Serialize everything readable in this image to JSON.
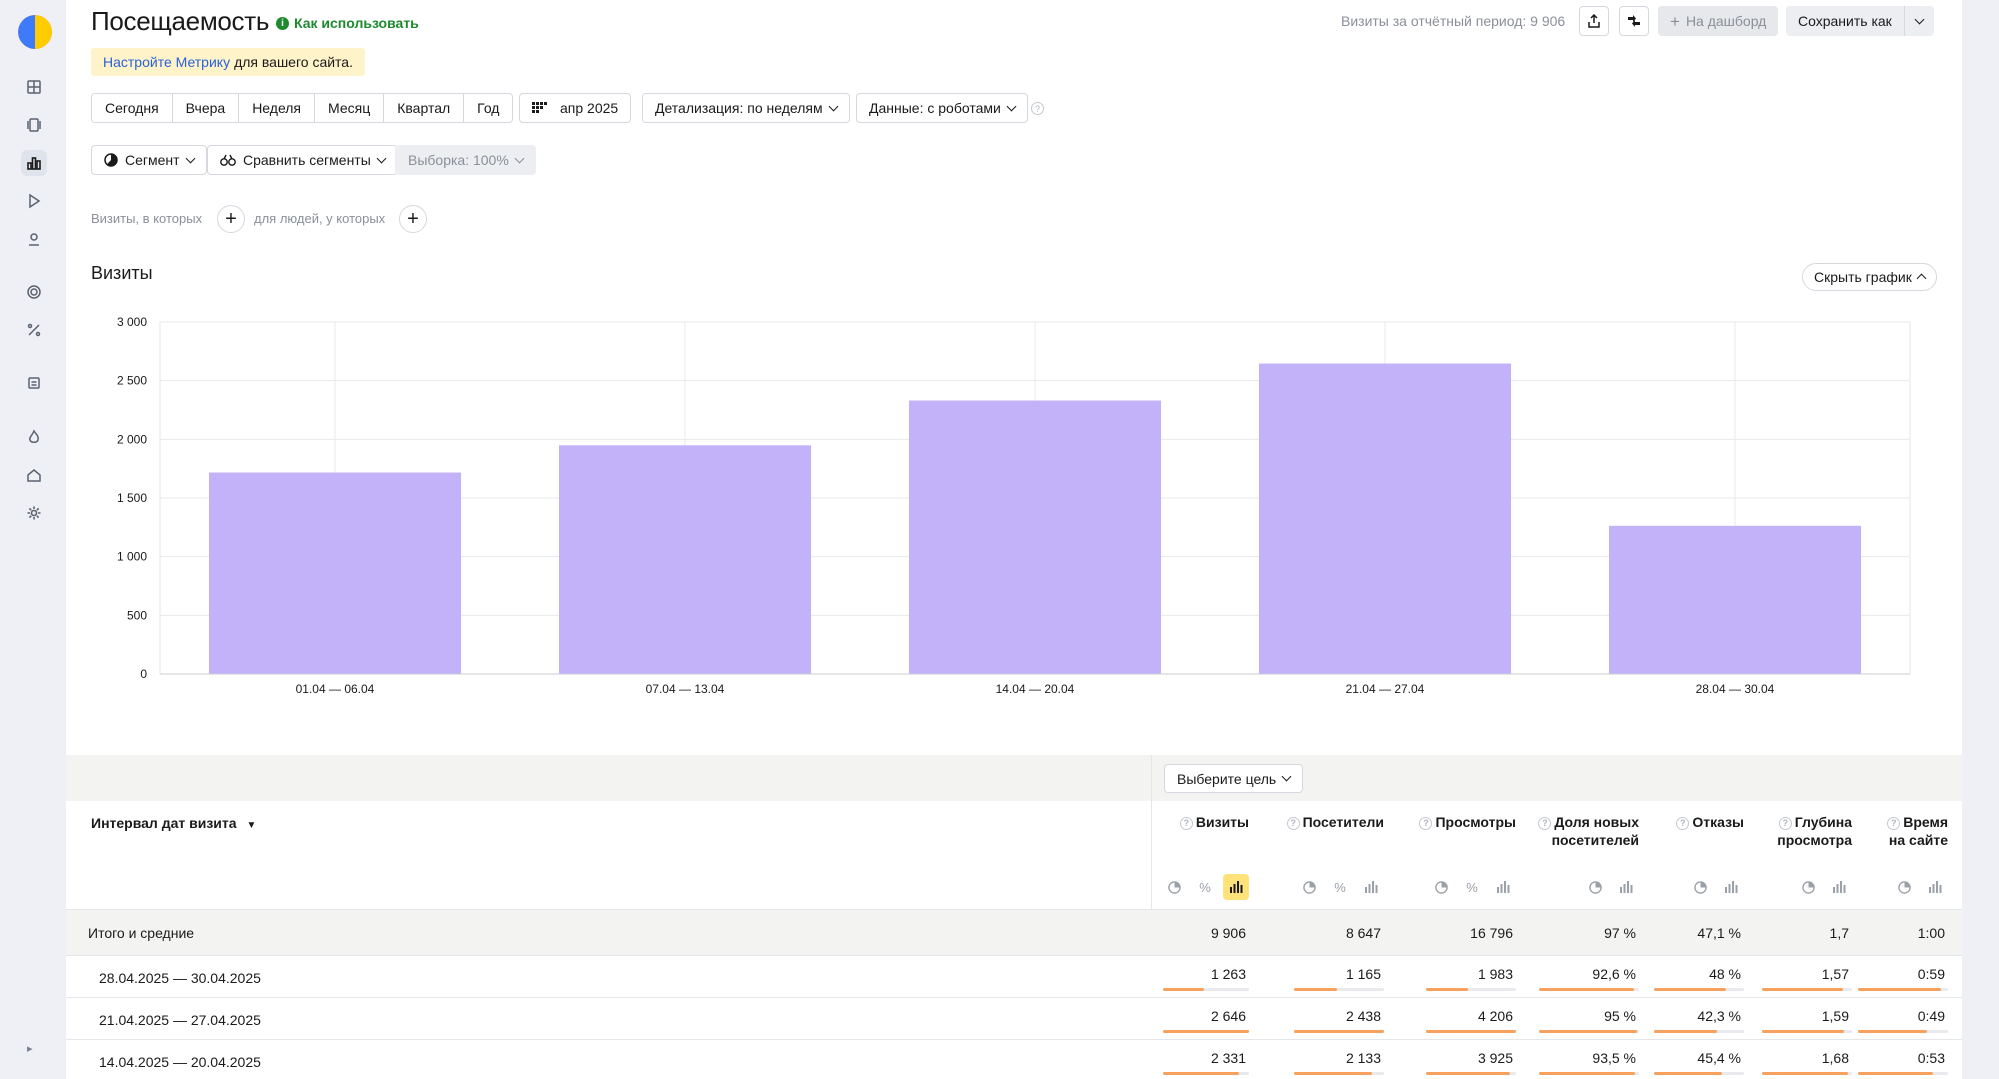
{
  "header": {
    "title": "Посещаемость",
    "how_to": "Как использовать",
    "visits_total": "Визиты за отчётный период: 9 906",
    "to_dashboard": "На дашборд",
    "save_as": "Сохранить как"
  },
  "banner": {
    "link": "Настройте Метрику",
    "text": "для вашего сайта."
  },
  "periods": [
    "Сегодня",
    "Вчера",
    "Неделя",
    "Месяц",
    "Квартал",
    "Год"
  ],
  "date_picker": "апр 2025",
  "detail": "Детализация: по неделям",
  "data_mode": "Данные: с роботами",
  "segment": "Сегмент",
  "compare_segments": "Сравнить сегменты",
  "sample": "Выборка: 100%",
  "filters": {
    "visits_where": "Визиты, в которых",
    "people_where": "для людей, у которых"
  },
  "chart_section": {
    "title": "Визиты",
    "hide_button": "Скрыть график"
  },
  "chart_data": {
    "type": "bar",
    "title": "Визиты",
    "categories": [
      "01.04 — 06.04",
      "07.04 — 13.04",
      "14.04 — 20.04",
      "21.04 — 27.04",
      "28.04 — 30.04"
    ],
    "values": [
      1717,
      1949,
      2331,
      2646,
      1263
    ],
    "ylim": [
      0,
      3000
    ],
    "yticks": [
      0,
      500,
      1000,
      1500,
      2000,
      2500,
      3000
    ],
    "ytick_labels": [
      "0",
      "500",
      "1 000",
      "1 500",
      "2 000",
      "2 500",
      "3 000"
    ],
    "grid": true,
    "color": "#c3b1fa"
  },
  "goal_select": "Выберите цель",
  "table": {
    "dimension_header": "Интервал дат визита",
    "sort_mark": "▼",
    "metrics": [
      {
        "label": "Визиты"
      },
      {
        "label": "Посетители"
      },
      {
        "label": "Просмотры"
      },
      {
        "label": "Доля новых посетителей"
      },
      {
        "label": "Отказы"
      },
      {
        "label": "Глубина просмотра"
      },
      {
        "label": "Время на сайте"
      }
    ],
    "totals": {
      "label": "Итого и средние",
      "values": [
        "9 906",
        "8 647",
        "16 796",
        "97 %",
        "47,1 %",
        "1,7",
        "1:00"
      ]
    },
    "rows": [
      {
        "label": "28.04.2025 — 30.04.2025",
        "values": [
          "1 263",
          "1 165",
          "1 983",
          "92,6 %",
          "48 %",
          "1,57",
          "0:59"
        ],
        "fill": [
          0.48,
          0.48,
          0.47,
          0.95,
          0.8,
          0.9,
          0.92
        ]
      },
      {
        "label": "21.04.2025 — 27.04.2025",
        "values": [
          "2 646",
          "2 438",
          "4 206",
          "95 %",
          "42,3 %",
          "1,59",
          "0:49"
        ],
        "fill": [
          1.0,
          1.0,
          1.0,
          0.98,
          0.7,
          0.91,
          0.77
        ]
      },
      {
        "label": "14.04.2025 — 20.04.2025",
        "values": [
          "2 331",
          "2 133",
          "3 925",
          "93,5 %",
          "45,4 %",
          "1,68",
          "0:53"
        ],
        "fill": [
          0.88,
          0.87,
          0.93,
          0.96,
          0.76,
          0.96,
          0.83
        ]
      }
    ]
  },
  "colors": {
    "accent_green": "#1d8a2e",
    "link_blue": "#2962d9",
    "bar": "#c3b1fa",
    "progress": "#f6a25e",
    "banner_bg": "#fff3c9",
    "tool_active": "#ffe27a"
  }
}
